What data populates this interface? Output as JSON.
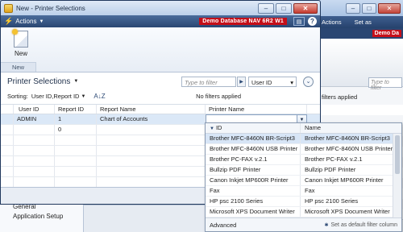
{
  "window": {
    "title": "New - Printer Selections",
    "actions_label": "Actions",
    "database_badge": "Demo Database NAV 6R2 W1",
    "controls": {
      "minimize": "–",
      "maximize": "□",
      "close": "✕"
    }
  },
  "ribbon": {
    "new_label": "New",
    "group_label": "New"
  },
  "page": {
    "title": "Printer Selections",
    "filter_placeholder": "Type to filter",
    "filter_field": "User ID",
    "sorting_label": "Sorting:",
    "sorting_value": "User ID,Report ID",
    "no_filters": "No filters applied"
  },
  "grid": {
    "columns": [
      "User ID",
      "Report ID",
      "Report Name",
      "Printer Name"
    ],
    "rows": [
      {
        "user_id": "ADMIN",
        "report_id": "1",
        "report_name": "Chart of Accounts",
        "printer_name": ""
      },
      {
        "user_id": "",
        "report_id": "0",
        "report_name": "",
        "printer_name": ""
      }
    ]
  },
  "lookup": {
    "columns": [
      "ID",
      "Name"
    ],
    "rows": [
      {
        "id": "Brother MFC-8460N BR-Script3",
        "name": "Brother MFC-8460N BR-Script3"
      },
      {
        "id": "Brother MFC-8460N USB Printer",
        "name": "Brother MFC-8460N USB Printer"
      },
      {
        "id": "Brother PC-FAX v.2.1",
        "name": "Brother PC-FAX v.2.1"
      },
      {
        "id": "Bullzip PDF Printer",
        "name": "Bullzip PDF Printer"
      },
      {
        "id": "Canon Inkjet MP600R Printer",
        "name": "Canon Inkjet MP600R Printer"
      },
      {
        "id": "Fax",
        "name": "Fax"
      },
      {
        "id": "HP psc 2100 Series",
        "name": "HP psc 2100 Series"
      },
      {
        "id": "Microsoft XPS Document Writer",
        "name": "Microsoft XPS Document Writer"
      }
    ],
    "advanced_label": "Advanced",
    "default_filter_label": "Set as default filter column"
  },
  "background": {
    "controls": {
      "minimize": "–",
      "maximize": "□",
      "close": "✕"
    },
    "actions_label": "Actions",
    "set_label": "Set as",
    "badge": "Demo Da",
    "filter_placeholder": "Type to filter",
    "filters_applied": "filters applied",
    "nav_items": [
      "General",
      "Application Setup"
    ]
  },
  "colors": {
    "action_bar": "#2a4672",
    "db_badge": "#c40e18",
    "selection": "#dbe8f7"
  }
}
